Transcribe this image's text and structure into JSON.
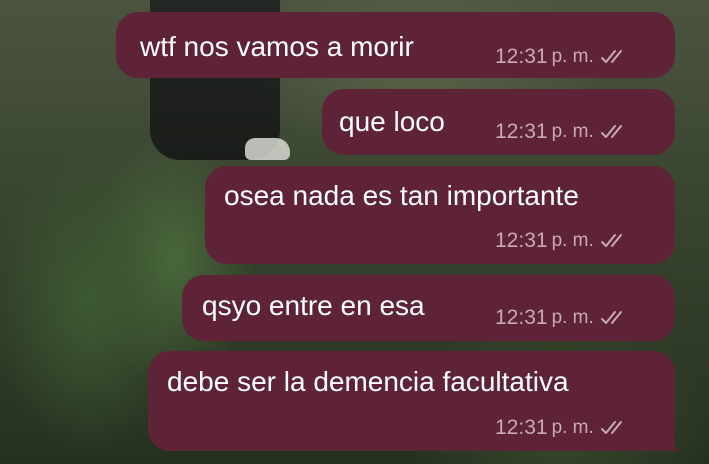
{
  "chat": {
    "accent_color": "#5e2336",
    "messages": [
      {
        "text": "wtf nos vamos a morir",
        "time": "12:31",
        "ampm": "p. m.",
        "status_icon": "double-check-icon"
      },
      {
        "text": "que loco",
        "time": "12:31",
        "ampm": "p. m.",
        "status_icon": "double-check-icon"
      },
      {
        "text": "osea nada es tan importante",
        "time": "12:31",
        "ampm": "p. m.",
        "status_icon": "double-check-icon"
      },
      {
        "text": "qsyo entre en esa",
        "time": "12:31",
        "ampm": "p. m.",
        "status_icon": "double-check-icon"
      },
      {
        "text": "debe ser la demencia facultativa",
        "time": "12:31",
        "ampm": "p. m.",
        "status_icon": "double-check-icon"
      }
    ]
  }
}
